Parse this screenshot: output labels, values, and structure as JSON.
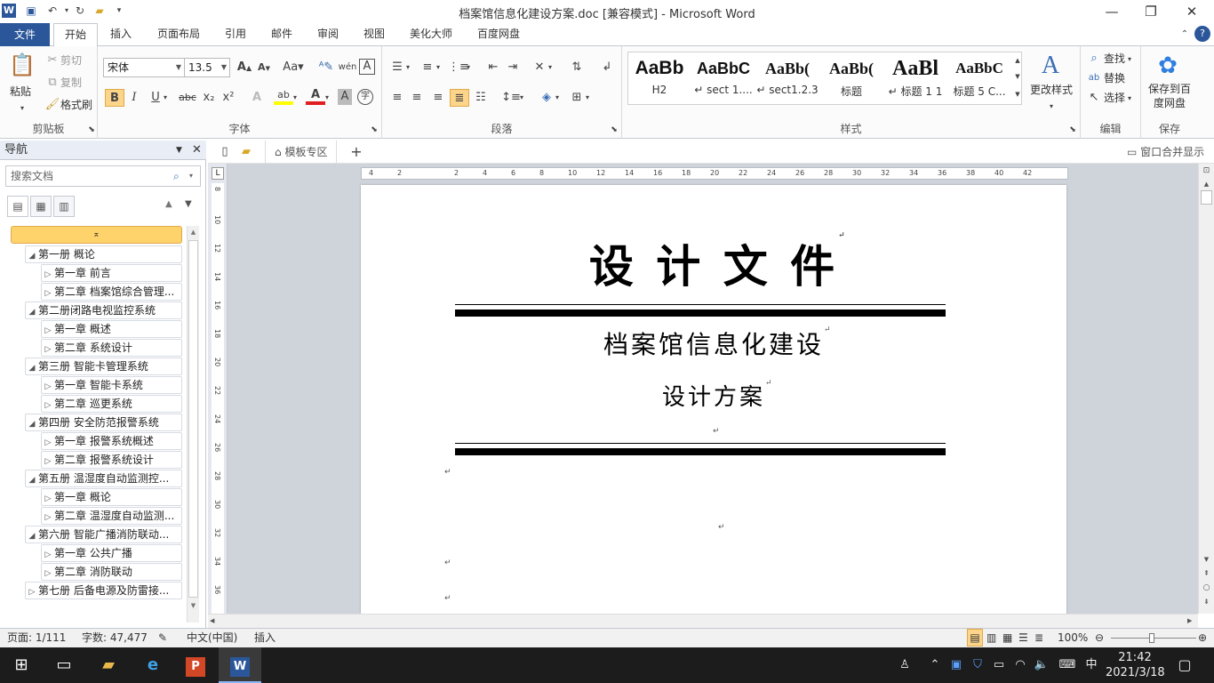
{
  "titlebar": {
    "title": "档案馆信息化建设方案.doc [兼容模式] - Microsoft Word"
  },
  "tabs": [
    "文件",
    "开始",
    "插入",
    "页面布局",
    "引用",
    "邮件",
    "审阅",
    "视图",
    "美化大师",
    "百度网盘"
  ],
  "ribbon": {
    "clipboard": {
      "label": "剪贴板",
      "paste": "粘贴",
      "cut": "剪切",
      "copy": "复制",
      "format_painter": "格式刷"
    },
    "font": {
      "label": "字体",
      "font_name": "宋体",
      "font_size": "13.5"
    },
    "paragraph": {
      "label": "段落"
    },
    "styles": {
      "label": "样式",
      "items": [
        {
          "preview": "AaBb",
          "name": "H2"
        },
        {
          "preview": "AaBbC",
          "name": "↵ sect 1...."
        },
        {
          "preview": "AaBb(",
          "name": "↵ sect1.2.3"
        },
        {
          "preview": "AaBb(",
          "name": "标题"
        },
        {
          "preview": "AaBl",
          "name": "↵ 标题 1 1"
        },
        {
          "preview": "AaBbC",
          "name": "标题 5 C..."
        }
      ],
      "change_styles": "更改样式"
    },
    "editing": {
      "label": "编辑",
      "find": "查找",
      "replace": "替换",
      "select": "选择"
    },
    "save": {
      "label": "保存",
      "button": "保存到百度网盘"
    }
  },
  "nav": {
    "title": "导航",
    "search_placeholder": "搜索文档",
    "items": [
      {
        "text": "第一册 概论",
        "level": 1,
        "expanded": true
      },
      {
        "text": "第一章 前言",
        "level": 2
      },
      {
        "text": "第二章 档案馆综合管理...",
        "level": 2
      },
      {
        "text": "第二册闭路电视监控系统",
        "level": 1,
        "expanded": true
      },
      {
        "text": "第一章 概述",
        "level": 2
      },
      {
        "text": "第二章 系统设计",
        "level": 2
      },
      {
        "text": "第三册 智能卡管理系统",
        "level": 1,
        "expanded": true
      },
      {
        "text": "第一章 智能卡系统",
        "level": 2
      },
      {
        "text": "第二章 巡更系统",
        "level": 2
      },
      {
        "text": "第四册 安全防范报警系统",
        "level": 1,
        "expanded": true
      },
      {
        "text": "第一章 报警系统概述",
        "level": 2
      },
      {
        "text": "第二章 报警系统设计",
        "level": 2
      },
      {
        "text": "第五册 温湿度自动监测控...",
        "level": 1,
        "expanded": true
      },
      {
        "text": "第一章 概论",
        "level": 2
      },
      {
        "text": "第二章 温湿度自动监测...",
        "level": 2
      },
      {
        "text": "第六册 智能广播消防联动...",
        "level": 1,
        "expanded": true
      },
      {
        "text": "第一章 公共广播",
        "level": 2
      },
      {
        "text": "第二章 消防联动",
        "level": 2
      },
      {
        "text": "第七册  后备电源及防雷接...",
        "level": 1,
        "expanded": false
      }
    ]
  },
  "docstrip": {
    "template_tab": "模板专区",
    "merge_window": "窗口合并显示"
  },
  "document": {
    "title": "设 计 文 件",
    "subtitle": "档案馆信息化建设",
    "subtitle2": "设计方案"
  },
  "status": {
    "page": "页面: 1/111",
    "words": "字数: 47,477",
    "language": "中文(中国)",
    "mode": "插入",
    "zoom": "100%"
  },
  "taskbar": {
    "time": "21:42",
    "date": "2021/3/18",
    "ime": "中"
  }
}
